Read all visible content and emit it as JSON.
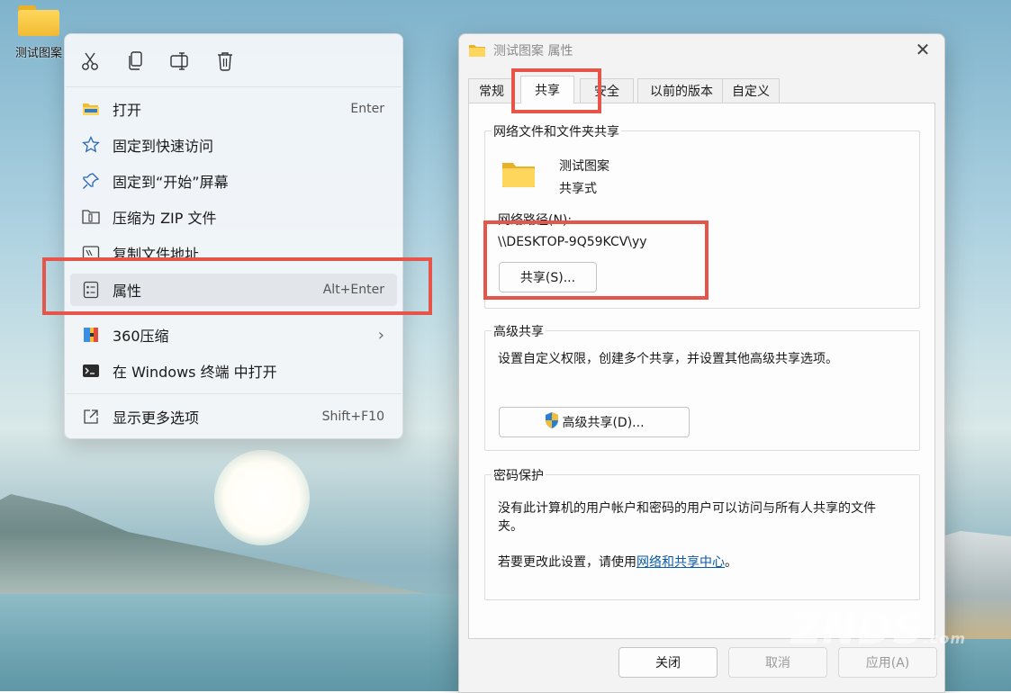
{
  "desktop": {
    "icon_label": "测试图案"
  },
  "context_menu": {
    "toolbar": [
      "cut-icon",
      "copy-icon",
      "rename-icon",
      "delete-icon"
    ],
    "items": [
      {
        "label": "打开",
        "shortcut": "Enter",
        "icon": "folder-open-icon"
      },
      {
        "label": "固定到快速访问",
        "shortcut": "",
        "icon": "star-icon"
      },
      {
        "label": "固定到“开始”屏幕",
        "shortcut": "",
        "icon": "pin-icon"
      },
      {
        "label": "压缩为 ZIP 文件",
        "shortcut": "",
        "icon": "zip-folder-icon"
      },
      {
        "label": "复制文件地址",
        "shortcut": "",
        "icon": "copy-path-icon"
      },
      {
        "label": "属性",
        "shortcut": "Alt+Enter",
        "icon": "properties-icon"
      },
      {
        "label": "360压缩",
        "shortcut": "",
        "icon": "360-compress-icon"
      },
      {
        "label": "在 Windows 终端 中打开",
        "shortcut": "",
        "icon": "terminal-icon"
      },
      {
        "label": "显示更多选项",
        "shortcut": "Shift+F10",
        "icon": "more-options-icon"
      }
    ]
  },
  "dialog": {
    "title": "测试图案 属性",
    "tabs": [
      "常规",
      "共享",
      "安全",
      "以前的版本",
      "自定义"
    ],
    "active_tab": "共享",
    "network_group": {
      "title": "网络文件和文件夹共享",
      "folder_name": "测试图案",
      "share_status": "共享式",
      "path_label": "网络路径(N):",
      "path_value": "\\\\DESKTOP-9Q59KCV\\yy",
      "share_button": "共享(S)..."
    },
    "advanced_group": {
      "title": "高级共享",
      "description": "设置自定义权限，创建多个共享，并设置其他高级共享选项。",
      "button": "高级共享(D)..."
    },
    "password_group": {
      "title": "密码保护",
      "line1": "没有此计算机的用户帐户和密码的用户可以访问与所有人共享的文件",
      "line2": "夹。",
      "change_prefix": "若要更改此设置，请使用",
      "change_link": "网络和共享中心",
      "change_suffix": "。"
    },
    "footer": {
      "close": "关闭",
      "cancel": "取消",
      "apply": "应用(A)"
    }
  },
  "colors": {
    "highlight": "#e6554a",
    "link": "#0a5aa8",
    "folder": "#f2bc33"
  },
  "watermark": {
    "text": "ZNDS",
    "suffix": ".com"
  }
}
